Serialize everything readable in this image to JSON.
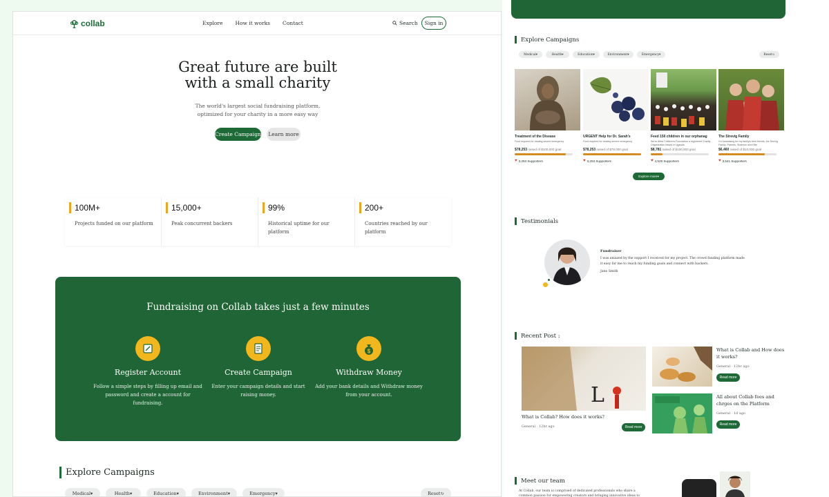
{
  "nav": {
    "logo": "collab",
    "links": [
      "Explore",
      "How it works",
      "Contact"
    ],
    "search": "Search",
    "signin": "Sign in"
  },
  "hero": {
    "title_line1": "Great future are built",
    "title_line2": "with a small charity",
    "subtitle_line1": "The world's largest social fundraising platform,",
    "subtitle_line2": "optimized for your charity in a more easy way",
    "create_btn": "Create Campaign",
    "learn_btn": "Learn more"
  },
  "stats": [
    {
      "value": "100M+",
      "label": "Projects funded on our platform"
    },
    {
      "value": "15,000+",
      "label": "Peak concurrent backers"
    },
    {
      "value": "99%",
      "label": "Historical uptime for our platform"
    },
    {
      "value": "200+",
      "label": "Countries reached by our platform"
    }
  ],
  "how": {
    "title": "Fundraising on Collab takes just a few minutes",
    "steps": [
      {
        "title": "Register Account",
        "desc": "Follow a simple steps by filling up email and password and create a account for fundraising."
      },
      {
        "title": "Create Campaign",
        "desc": "Enter your campaign details and start raising money."
      },
      {
        "title": "Withdraw Money",
        "desc": "Add your bank details and Withdraw money from your account."
      }
    ]
  },
  "explore": {
    "title": "Explore Campaigns",
    "filters": [
      "Medical",
      "Health",
      "Education",
      "Environment",
      "Emergency"
    ],
    "reset": "Reset",
    "more_btn": "Explore more"
  },
  "campaigns": [
    {
      "title": "Treatment of the Disease",
      "desc": "Fund required for treating severe emergency",
      "raised": "$78,253",
      "goal_text": "raised of $100,000 goal",
      "progress": 0.88,
      "supporters": "3,253 Supporters"
    },
    {
      "title": "URGENT Help for Dr. Sarah's",
      "desc": "Fund required for treating severe emergency",
      "raised": "$78,253",
      "goal_text": "raised of $78,000 goal",
      "progress": 1.0,
      "supporters": "3,253 Supporters"
    },
    {
      "title": "Feed 150 children in our orphanag",
      "desc": "We're Alfea Children's Foundation a registered Charity Organisation based in Uganda.",
      "raised": "$8,781",
      "goal_text": "raised of $100,000 goal",
      "progress": 0.2,
      "supporters": "4,529 Supporters"
    },
    {
      "title": "The Strevig Family",
      "desc": "I'm fundraising for my family's best friends, the Strevig Family: Parents, Shannon and Ellie",
      "raised": "$6,460",
      "goal_text": "raised of $10,000 goal",
      "progress": 0.8,
      "supporters": "3,541 Supporters"
    }
  ],
  "testimonials": {
    "title": "Testimonials",
    "role": "Fundraiser",
    "quote": "I was amazed by the support I received for my project. The crowd funding platform made it easy for me to reach my funding goals and connect with backers.",
    "author": "Jane Smith"
  },
  "posts": {
    "title": "Recent Post :",
    "items": [
      {
        "title": "What is Collab? How does it works?",
        "meta": "General  · 12hr ago",
        "btn": "Read more"
      },
      {
        "title": "What is Collab and How does it works?",
        "meta": "General  · 12hr ago",
        "btn": "Read more"
      },
      {
        "title": "All about Collab fees and chrges on the Platform",
        "meta": "General  · 1d ago",
        "btn": "Read more"
      }
    ]
  },
  "team": {
    "title": "Meet our team",
    "desc": "At Collab, our team is comprised of dedicated professionals who share a common passion for empowering creators and bringing innovative ideas to life. With"
  },
  "colors": {
    "brand": "#1f6535",
    "accent": "#f3b71e",
    "bg": "#eefaf0"
  }
}
